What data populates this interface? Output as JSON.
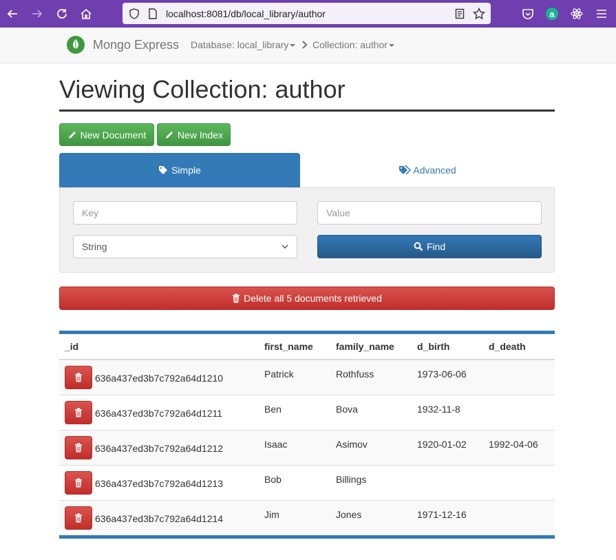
{
  "browser": {
    "url_host": "localhost",
    "url_path": ":8081/db/local_library/author"
  },
  "navbar": {
    "brand": "Mongo Express",
    "database_label": "Database: local_library",
    "collection_label": "Collection: author"
  },
  "page": {
    "title": "Viewing Collection: author"
  },
  "actions": {
    "new_document": "New Document",
    "new_index": "New Index"
  },
  "tabs": {
    "simple": "Simple",
    "advanced": "Advanced"
  },
  "search": {
    "key_placeholder": "Key",
    "value_placeholder": "Value",
    "type_selected": "String",
    "find_label": "Find"
  },
  "delete_all_label": "Delete all 5 documents retrieved",
  "table": {
    "columns": [
      "_id",
      "first_name",
      "family_name",
      "d_birth",
      "d_death"
    ],
    "rows": [
      {
        "_id": "636a437ed3b7c792a64d1210",
        "first_name": "Patrick",
        "family_name": "Rothfuss",
        "d_birth": "1973-06-06",
        "d_death": ""
      },
      {
        "_id": "636a437ed3b7c792a64d1211",
        "first_name": "Ben",
        "family_name": "Bova",
        "d_birth": "1932-11-8",
        "d_death": ""
      },
      {
        "_id": "636a437ed3b7c792a64d1212",
        "first_name": "Isaac",
        "family_name": "Asimov",
        "d_birth": "1920-01-02",
        "d_death": "1992-04-06"
      },
      {
        "_id": "636a437ed3b7c792a64d1213",
        "first_name": "Bob",
        "family_name": "Billings",
        "d_birth": "",
        "d_death": ""
      },
      {
        "_id": "636a437ed3b7c792a64d1214",
        "first_name": "Jim",
        "family_name": "Jones",
        "d_birth": "1971-12-16",
        "d_death": ""
      }
    ]
  },
  "colors": {
    "browser_accent": "#6f3fb0",
    "primary": "#337ab7",
    "success": "#5cb85c",
    "danger": "#d9534f"
  },
  "icons": {
    "back": "arrow-left-icon",
    "forward": "arrow-right-icon",
    "reload": "reload-icon",
    "home": "home-icon",
    "shield": "shield-icon",
    "page": "page-icon",
    "reader": "reader-view-icon",
    "bookmark": "star-icon",
    "pocket": "pocket-icon",
    "extension_a": "extension-a-icon",
    "react": "react-devtools-icon",
    "menu": "hamburger-menu-icon",
    "pencil": "pencil-icon",
    "tag": "tag-icon",
    "tags": "tags-icon",
    "search": "search-icon",
    "trash": "trash-icon"
  }
}
